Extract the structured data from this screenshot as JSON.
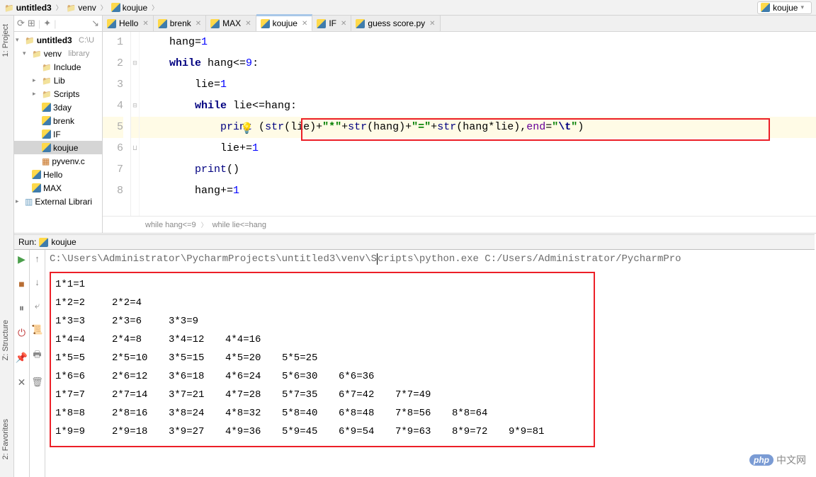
{
  "breadcrumbs": {
    "project": "untitled3",
    "venv": "venv",
    "file": "koujue"
  },
  "run_config": "koujue",
  "left_rail": {
    "project": "1: Project",
    "structure": "Z: Structure",
    "favorites": "2: Favorites"
  },
  "project_tree": {
    "root": "untitled3",
    "root_hint": "C:\\U",
    "venv": "venv",
    "venv_hint": "library",
    "include": "Include",
    "lib": "Lib",
    "scripts": "Scripts",
    "f_3day": "3day",
    "f_brenk": "brenk",
    "f_if": "IF",
    "f_koujue": "koujue",
    "f_pyvenv": "pyvenv.c",
    "f_hello": "Hello",
    "f_max": "MAX",
    "external": "External Librari"
  },
  "tabs": {
    "t1": "Hello",
    "t2": "brenk",
    "t3": "MAX",
    "t4": "koujue",
    "t5": "IF",
    "t6": "guess score.py"
  },
  "code": {
    "l1a": "hang",
    "l1b": "=",
    "l1c": "1",
    "l2a": "while",
    "l2b": " hang<=",
    "l2c": "9",
    "l2d": ":",
    "l3a": "lie=",
    "l3b": "1",
    "l4a": "while",
    "l4b": " lie<=hang:",
    "l5a": "print",
    "l5b": " (",
    "l5c": "str",
    "l5d": "(lie)+",
    "l5e": "\"*\"",
    "l5f": "+",
    "l5g": "str",
    "l5h": "(hang)+",
    "l5i": "\"=\"",
    "l5j": "+",
    "l5k": "str",
    "l5l": "(hang*lie),",
    "l5m": "end",
    "l5n": "=",
    "l5o_open": "\"",
    "l5o": "\\t",
    "l5o_close": "\"",
    "l5p": ")",
    "l6a": "lie+=",
    "l6b": "1",
    "l7a": "print",
    "l7b": "()",
    "l8a": "hang+=",
    "l8b": "1"
  },
  "crumb_bar": {
    "c1": "while hang<=9",
    "c2": "while lie<=hang"
  },
  "run_header": {
    "label": "Run:",
    "target": "koujue"
  },
  "console_cmd": {
    "pre": "C:\\Users\\Administrator\\PycharmProjects\\untitled3\\venv\\S",
    "post": "cripts\\python.exe C:/Users/Administrator/PycharmPro"
  },
  "table": {
    "r1": [
      "1*1=1"
    ],
    "r2": [
      "1*2=2",
      "2*2=4"
    ],
    "r3": [
      "1*3=3",
      "2*3=6",
      "3*3=9"
    ],
    "r4": [
      "1*4=4",
      "2*4=8",
      "3*4=12",
      "4*4=16"
    ],
    "r5": [
      "1*5=5",
      "2*5=10",
      "3*5=15",
      "4*5=20",
      "5*5=25"
    ],
    "r6": [
      "1*6=6",
      "2*6=12",
      "3*6=18",
      "4*6=24",
      "5*6=30",
      "6*6=36"
    ],
    "r7": [
      "1*7=7",
      "2*7=14",
      "3*7=21",
      "4*7=28",
      "5*7=35",
      "6*7=42",
      "7*7=49"
    ],
    "r8": [
      "1*8=8",
      "2*8=16",
      "3*8=24",
      "4*8=32",
      "5*8=40",
      "6*8=48",
      "7*8=56",
      "8*8=64"
    ],
    "r9": [
      "1*9=9",
      "2*9=18",
      "3*9=27",
      "4*9=36",
      "5*9=45",
      "6*9=54",
      "7*9=63",
      "8*9=72",
      "9*9=81"
    ]
  },
  "watermark": "中文网"
}
